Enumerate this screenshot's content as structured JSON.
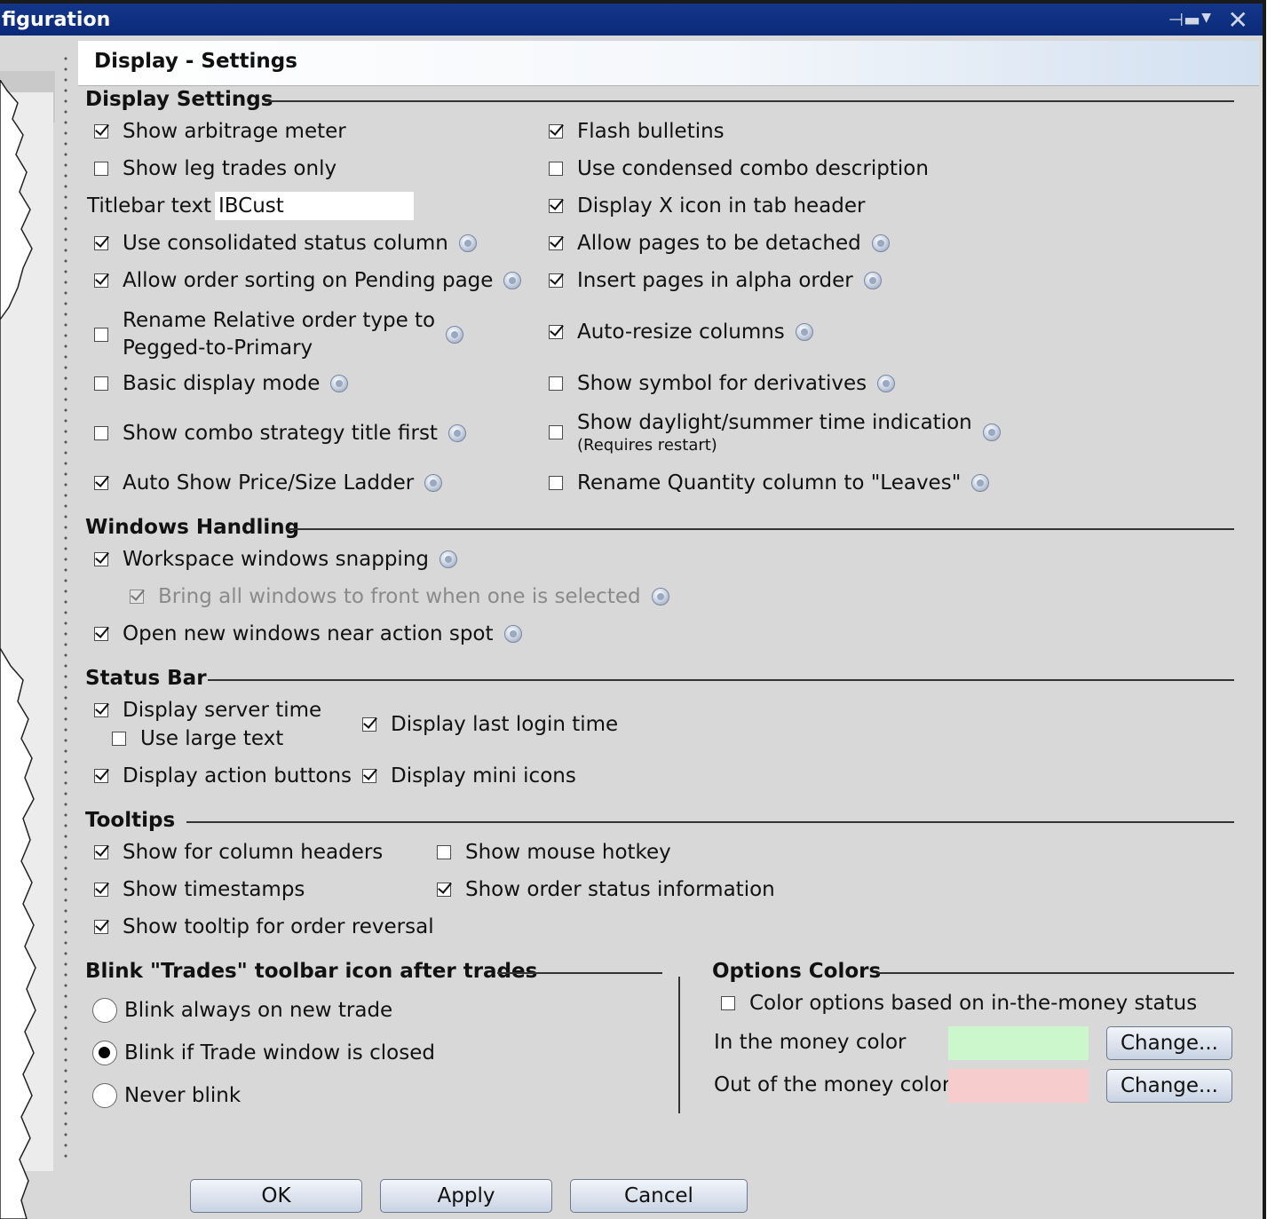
{
  "window": {
    "title": "figuration"
  },
  "header": {
    "title": "Display - Settings"
  },
  "display_settings": {
    "heading": "Display Settings",
    "show_arbitrage_meter": {
      "label": "Show arbitrage meter",
      "checked": true
    },
    "show_leg_trades_only": {
      "label": "Show leg trades only",
      "checked": false
    },
    "titlebar_text": {
      "label": "Titlebar text",
      "value": "IBCust"
    },
    "use_consolidated_status_column": {
      "label": "Use consolidated status column",
      "checked": true
    },
    "allow_order_sorting": {
      "label": "Allow order sorting on Pending page",
      "checked": true
    },
    "rename_relative_order": {
      "label_line1": "Rename Relative order type to",
      "label_line2": "Pegged-to-Primary",
      "checked": false
    },
    "basic_display_mode": {
      "label": "Basic display mode",
      "checked": false
    },
    "show_combo_strategy_title_first": {
      "label": "Show combo strategy title first",
      "checked": false
    },
    "auto_show_price_size_ladder": {
      "label": "Auto Show Price/Size Ladder",
      "checked": true
    },
    "flash_bulletins": {
      "label": "Flash bulletins",
      "checked": true
    },
    "use_condensed_combo": {
      "label": "Use condensed combo description",
      "checked": false
    },
    "display_x_icon": {
      "label": "Display X icon in tab header",
      "checked": true
    },
    "allow_pages_detached": {
      "label": "Allow pages to be detached",
      "checked": true
    },
    "insert_pages_alpha": {
      "label": "Insert pages in alpha order",
      "checked": true
    },
    "auto_resize_columns": {
      "label": "Auto-resize columns",
      "checked": true
    },
    "show_symbol_derivatives": {
      "label": "Show symbol for derivatives",
      "checked": false
    },
    "show_daylight": {
      "label": "Show daylight/summer time indication",
      "note": "(Requires restart)",
      "checked": false
    },
    "rename_quantity_column": {
      "label": "Rename Quantity column to \"Leaves\"",
      "checked": false
    }
  },
  "windows_handling": {
    "heading": "Windows Handling",
    "workspace_snapping": {
      "label": "Workspace windows snapping",
      "checked": true
    },
    "bring_all_windows": {
      "label": "Bring all windows to  front when one is selected",
      "checked": true,
      "disabled": true
    },
    "open_near_action_spot": {
      "label": "Open new windows near action spot",
      "checked": true
    }
  },
  "status_bar": {
    "heading": "Status Bar",
    "display_server_time": {
      "label": "Display server time",
      "checked": true
    },
    "use_large_text": {
      "label": "Use large text",
      "checked": false
    },
    "display_last_login": {
      "label": "Display last login time",
      "checked": true
    },
    "display_action_buttons": {
      "label": "Display action buttons",
      "checked": true
    },
    "display_mini_icons": {
      "label": "Display mini icons",
      "checked": true
    }
  },
  "tooltips": {
    "heading": "Tooltips",
    "column_headers": {
      "label": "Show for column headers",
      "checked": true
    },
    "mouse_hotkey": {
      "label": "Show mouse hotkey",
      "checked": false
    },
    "timestamps": {
      "label": "Show timestamps",
      "checked": true
    },
    "order_status_info": {
      "label": "Show order status information",
      "checked": true
    },
    "order_reversal": {
      "label": "Show tooltip for order reversal",
      "checked": true
    }
  },
  "blink": {
    "heading": "Blink \"Trades\" toolbar icon after trades",
    "options": [
      {
        "label": "Blink always on new trade",
        "selected": false
      },
      {
        "label": "Blink if Trade window is closed",
        "selected": true
      },
      {
        "label": "Never blink",
        "selected": false
      }
    ]
  },
  "options_colors": {
    "heading": "Options Colors",
    "color_based": {
      "label": "Color options based on in-the-money status",
      "checked": false
    },
    "in_the_money": {
      "label": "In the money color",
      "color": "#ccf7cc",
      "button": "Change..."
    },
    "out_of_money": {
      "label": "Out of the money color",
      "color": "#f7cccc",
      "button": "Change..."
    }
  },
  "footer": {
    "ok": "OK",
    "apply": "Apply",
    "cancel": "Cancel"
  },
  "icons": [
    "pin-icon",
    "dropdown-icon",
    "close-icon",
    "help-icon"
  ]
}
